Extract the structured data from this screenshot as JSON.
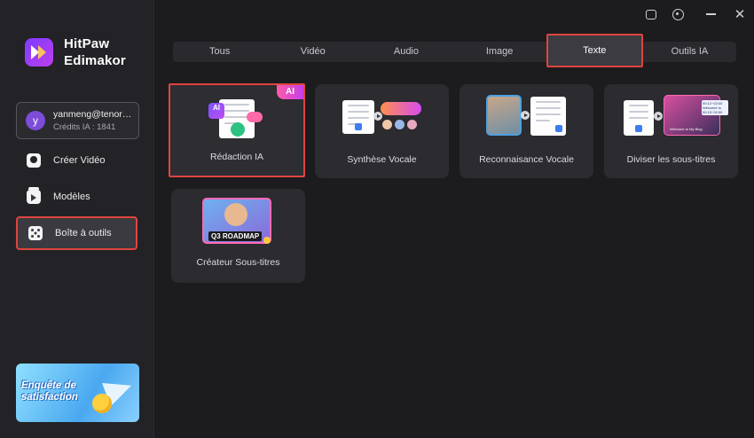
{
  "app": {
    "name_line1": "HitPaw",
    "name_line2": "Edimakor"
  },
  "account": {
    "avatar_letter": "y",
    "email": "yanmeng@tenorshare.cn",
    "credits": "Crédits IA : 1841"
  },
  "sidebar": {
    "items": [
      {
        "label": "Créer Vidéo",
        "icon": "video-icon"
      },
      {
        "label": "Modèles",
        "icon": "templates-icon"
      },
      {
        "label": "Boîte à outils",
        "icon": "toolbox-icon",
        "active": true
      }
    ],
    "promo_text": "Enquête de satisfaction"
  },
  "tabs": [
    {
      "label": "Tous"
    },
    {
      "label": "Vidéo"
    },
    {
      "label": "Audio"
    },
    {
      "label": "Image"
    },
    {
      "label": "Texte",
      "active": true
    },
    {
      "label": "Outils IA"
    }
  ],
  "tools": [
    {
      "label": "Rédaction IA",
      "badge": "AI",
      "selected": true
    },
    {
      "label": "Synthèse Vocale"
    },
    {
      "label": "Reconnaisance Vocale"
    },
    {
      "label": "Diviser les sous-titres"
    },
    {
      "label": "Créateur Sous-titres"
    }
  ],
  "thumb_text": {
    "ai_doc": "AI",
    "roadmap": "Q3 ROADMAP",
    "sub_lines": [
      "00:12~02:00",
      "Welcome to",
      "00:15~02:00",
      "Welcome to My Blog"
    ]
  },
  "colors": {
    "accent_highlight": "#e0443e",
    "sidebar_bg": "#232327",
    "card_bg": "#2b2b30",
    "brand_purple": "#7b3cff"
  }
}
